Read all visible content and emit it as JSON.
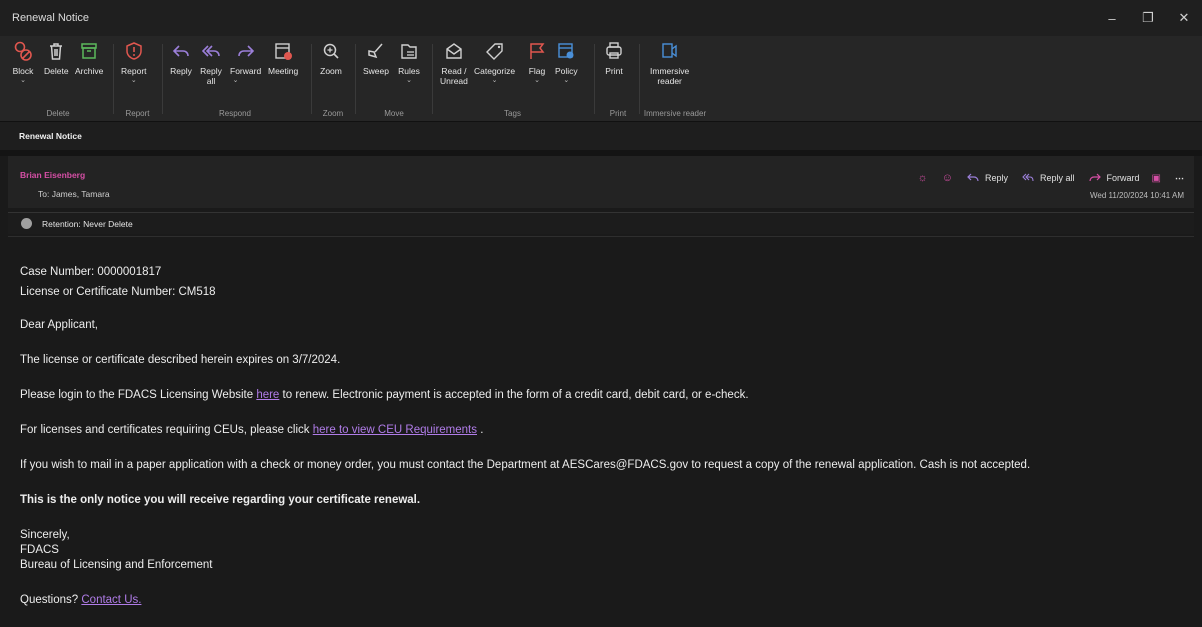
{
  "window": {
    "title": "Renewal Notice",
    "controls": [
      "minimize",
      "restore",
      "close"
    ]
  },
  "ribbon": {
    "groups": [
      {
        "label": "Delete",
        "buttons": [
          "Block",
          "Delete",
          "Archive"
        ]
      },
      {
        "label": "Report",
        "buttons": [
          "Report"
        ]
      },
      {
        "label": "Respond",
        "buttons": [
          "Reply",
          "Reply all",
          "Forward",
          "Meeting"
        ]
      },
      {
        "label": "Zoom",
        "buttons": [
          "Zoom"
        ]
      },
      {
        "label": "Move",
        "buttons": [
          "Sweep",
          "Rules"
        ]
      },
      {
        "label": "Tags",
        "buttons": [
          "Read / Unread",
          "Categorize",
          "Flag",
          "Policy"
        ]
      },
      {
        "label": "Print",
        "buttons": [
          "Print"
        ]
      },
      {
        "label": "Immersive reader",
        "buttons": [
          "Immersive reader"
        ]
      }
    ],
    "labels": {
      "block": "Block",
      "delete": "Delete",
      "archive": "Archive",
      "report": "Report",
      "reply": "Reply",
      "reply_all_1": "Reply",
      "reply_all_2": "all",
      "forward": "Forward",
      "meeting": "Meeting",
      "zoom": "Zoom",
      "sweep": "Sweep",
      "rules": "Rules",
      "read_1": "Read /",
      "read_2": "Unread",
      "categorize": "Categorize",
      "flag": "Flag",
      "policy": "Policy",
      "print": "Print",
      "immersive_1": "Immersive",
      "immersive_2": "reader",
      "g_delete": "Delete",
      "g_report": "Report",
      "g_respond": "Respond",
      "g_zoom": "Zoom",
      "g_move": "Move",
      "g_tags": "Tags",
      "g_print": "Print",
      "g_immersive": "Immersive reader"
    }
  },
  "message": {
    "subject": "Renewal Notice",
    "sender": "Brian Eisenberg",
    "to": "To:  James, Tamara",
    "date": "Wed 11/20/2024 10:41 AM",
    "retention": "Retention: Never Delete",
    "actions": {
      "reply": "Reply",
      "reply_all": "Reply all",
      "forward": "Forward"
    }
  },
  "body": {
    "case": "Case Number: 0000001817",
    "license": "License or Certificate Number: CM518",
    "greeting": "Dear Applicant,",
    "expires": "The license or certificate described herein expires on 3/7/2024.",
    "login_pre": "Please login to the FDACS Licensing Website ",
    "login_link": "here",
    "login_post": " to renew. Electronic payment is accepted in the form of a credit card, debit card, or e-check.",
    "ceu_pre": "For licenses and certificates requiring CEUs, please click ",
    "ceu_link": "here to view CEU Requirements",
    "ceu_post": " .",
    "mail": "If you wish to mail in a paper application with a check or money order, you must contact the Department at AESCares@FDACS.gov to request a copy of the renewal application. Cash is not accepted.",
    "only_notice": "This is the only notice you will receive regarding your certificate renewal.",
    "sincerely": "Sincerely,",
    "org": "FDACS",
    "bureau": "Bureau of Licensing and Enforcement",
    "questions": "Questions? ",
    "contact_link": "Contact Us."
  },
  "colors": {
    "accent_pink": "#d64fa6",
    "link": "#b07ce8",
    "report_red": "#e0574f",
    "tag_blue": "#4a90d9"
  }
}
